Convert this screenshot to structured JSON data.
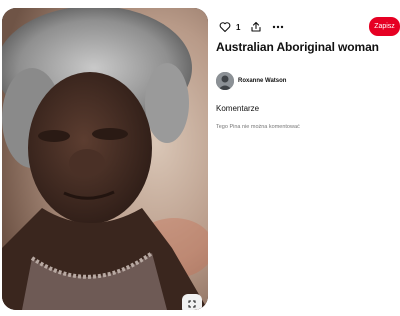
{
  "pin": {
    "image_alt": "Australian Aboriginal woman",
    "title": "Australian Aboriginal woman",
    "image_action_icon": "visual-search-icon"
  },
  "toolbar": {
    "like_icon": "heart-icon",
    "like_count": "1",
    "share_icon": "share-icon",
    "more_icon": "ellipsis-icon"
  },
  "save": {
    "label": "Zapisz",
    "color": "#e60023"
  },
  "author": {
    "name": "Roxanne Watson"
  },
  "comments": {
    "heading": "Komentarze",
    "disabled_note": "Tego Pina nie można komentować"
  }
}
